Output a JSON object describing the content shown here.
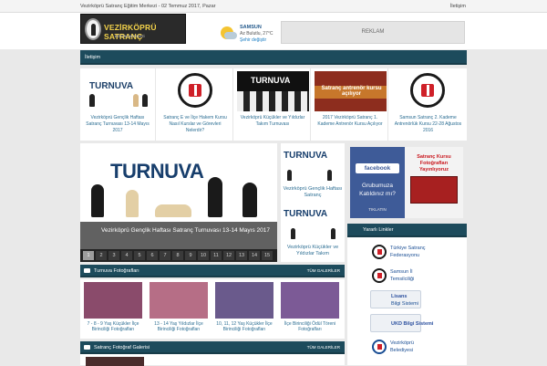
{
  "topbar": {
    "date": "Vezirköprü Satranç Eğitim Merkezi - 02 Temmuz 2017, Pazar",
    "contact": "İletişim"
  },
  "header": {
    "logo_name": "VEZİRKÖPRÜ SATRANÇ",
    "logo_sub": "EĞİTİM MERKEZİ",
    "weather": {
      "city": "SAMSUN",
      "condition": "Az Bulutlu, 27°C",
      "change": "Şehir değiştir"
    },
    "ad": "REKLAM"
  },
  "nav": {
    "items": [
      "İletişim"
    ]
  },
  "news_strip": [
    {
      "thumb_text": "TURNUVA",
      "caption": "Vezirköprü Gençlik Haftası Satranç Turnuvası 13-14 Mayıs 2017"
    },
    {
      "thumb_text": "",
      "caption": "Satranç E ve İlçe Hakem Kursu Nasıl Kurslar ve Görevleri Nelerdir?"
    },
    {
      "thumb_text": "TURNUVA",
      "caption": "Vezirköprü Küçükler ve Yıldızlar Takım Turnuvası"
    },
    {
      "thumb_text": "Satranç antrenör kursu açılıyor",
      "caption": "2017 Vezirköprü Satranç 1. Kademe Antrenör Kursu Açılıyor"
    },
    {
      "thumb_text": "",
      "caption": "Samsun Satranç 2. Kademe Antrenörlük Kursu 22-28 Ağustos 2016"
    }
  ],
  "hero": {
    "image_text": "TURNUVA",
    "caption": "Vezirköprü Gençlik Haftası Satranç Turnuvası 13-14 Mayıs 2017",
    "pages": [
      "1",
      "2",
      "3",
      "4",
      "5",
      "6",
      "7",
      "8",
      "9",
      "10",
      "11",
      "12",
      "13",
      "14",
      "15"
    ],
    "active_page": "1"
  },
  "side_news": [
    {
      "thumb_text": "TURNUVA",
      "caption": "Vezirköprü Gençlik Haftası Satranç"
    },
    {
      "thumb_text": "TURNUVA",
      "caption": "Vezirköprü Küçükler ve Yıldızlar Takım"
    }
  ],
  "facebook": {
    "brand": "facebook",
    "join": "Grubumuza Katıldınız mı?",
    "click": "TIKLATIN",
    "promo": "Satranç Kursu Fotoğrafları Yayınlıyoruz"
  },
  "photos": {
    "title": "Turnuva Fotoğrafları",
    "all": "TÜM GALERİLER",
    "items": [
      {
        "caption": "7 - 8 - 9 Yaş Küçükler İlçe Birinciliği Fotoğrafları"
      },
      {
        "caption": "13 - 14 Yaş Yıldızlar İlçe Birinciliği Fotoğrafları"
      },
      {
        "caption": "10, 11, 12 Yaş Küçükler İlçe Birinciliği Fotoğrafları"
      },
      {
        "caption": "İlçe Birinciliği Ödül Töreni Fotoğrafları"
      }
    ]
  },
  "gallery": {
    "title": "Satranç Fotoğraf Galerisi",
    "all": "TÜM GALERİLER"
  },
  "links": {
    "title": "Yararlı Linkler",
    "items": [
      {
        "line1": "Türkiye Satranç",
        "line2": "Federasyonu"
      },
      {
        "line1": "Samsun İl",
        "line2": "Temsilciliği"
      },
      {
        "line1": "Lisans",
        "line2": "Bilgi Sistemi"
      },
      {
        "line1": "UKD Bilgi Sistemi",
        "line2": ""
      },
      {
        "line1": "Vezirköprü",
        "line2": "Belediyesi"
      }
    ]
  }
}
